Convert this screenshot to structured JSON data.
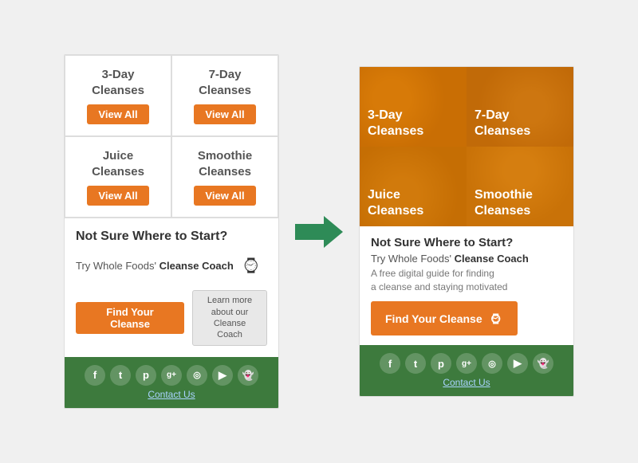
{
  "left_panel": {
    "grid": [
      {
        "title": "3-Day\nCleanses",
        "btn": "View All"
      },
      {
        "title": "7-Day\nCleanses",
        "btn": "View All"
      },
      {
        "title": "Juice\nCleanses",
        "btn": "View All"
      },
      {
        "title": "Smoothie\nCleanses",
        "btn": "View All"
      }
    ],
    "not_sure_title": "Not Sure Where to Start?",
    "try_text": "Try Whole Foods'",
    "cleanse_coach": "Cleanse Coach",
    "find_btn": "Find Your Cleanse",
    "learn_btn_line1": "Learn more",
    "learn_btn_line2": "about our",
    "learn_btn_line3": "Cleanse Coach"
  },
  "right_panel": {
    "grid": [
      {
        "title": "3-Day\nCleanses",
        "bg_class": "bg-citrus"
      },
      {
        "title": "7-Day\nCleanses",
        "bg_class": "bg-greens"
      },
      {
        "title": "Juice\nCleanses",
        "bg_class": "bg-juice"
      },
      {
        "title": "Smoothie\nCleanses",
        "bg_class": "bg-smoothie"
      }
    ],
    "not_sure_title": "Not Sure Where to Start?",
    "try_text": "Try Whole Foods'",
    "cleanse_coach": "Cleanse Coach",
    "free_guide": "A free digital guide for finding\na cleanse and staying motivated",
    "find_btn": "Find Your Cleanse"
  },
  "footer": {
    "social_icons": [
      "f",
      "t",
      "p",
      "g+",
      "📷",
      "▶",
      "👻"
    ],
    "contact": "Contact Us"
  },
  "arrow": {
    "color": "#2e8b57",
    "label": "arrow-right"
  }
}
